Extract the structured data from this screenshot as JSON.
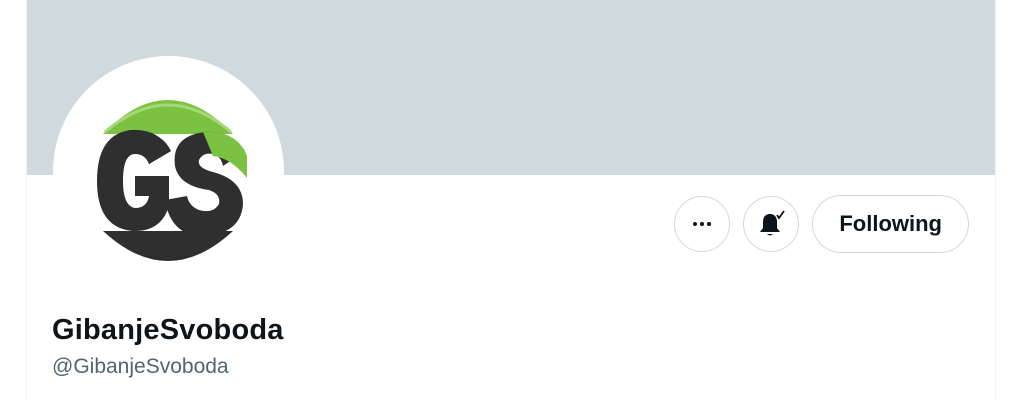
{
  "profile": {
    "display_name": "GibanjeSvoboda",
    "handle": "@GibanjeSvoboda",
    "avatar_logo_text": "GS"
  },
  "actions": {
    "more_icon": "more-horizontal-icon",
    "notification_icon": "bell-check-icon",
    "follow_label": "Following"
  },
  "colors": {
    "banner": "#cfd9de",
    "logo_green": "#7cc242",
    "logo_dark": "#2f2f2f",
    "text_primary": "#0f1419",
    "text_secondary": "#536471"
  }
}
